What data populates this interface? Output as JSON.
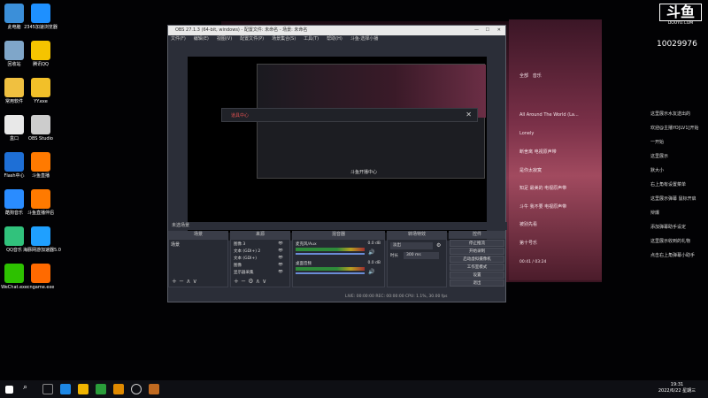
{
  "desktop": {
    "icons": [
      {
        "label": "此电脑",
        "color": "#3b8fd9"
      },
      {
        "label": "2345加速浏览器",
        "color": "#1e90ff"
      },
      {
        "label": "回收站",
        "color": "#7fa6c9"
      },
      {
        "label": "腾讯QQ",
        "color": "#f5c400"
      },
      {
        "label": "常用软件",
        "color": "#f0c040"
      },
      {
        "label": "YY.exe",
        "color": "#f2c029"
      },
      {
        "label": "盒口",
        "color": "#e8e8e8"
      },
      {
        "label": "OBS Studio",
        "color": "#cccccc"
      },
      {
        "label": "Flash中心",
        "color": "#1e6fd6"
      },
      {
        "label": "斗鱼直播",
        "color": "#ff7a00"
      },
      {
        "label": "酷狗音乐",
        "color": "#2a8cff"
      },
      {
        "label": "斗鱼直播伴侣",
        "color": "#ff7a00"
      },
      {
        "label": "QQ音乐",
        "color": "#31c27c"
      },
      {
        "label": "海豚网游加速器5.0",
        "color": "#1fa0ff"
      },
      {
        "label": "WeChat.exe",
        "color": "#2dc100"
      },
      {
        "label": "cngame.exe",
        "color": "#ff6a00"
      }
    ]
  },
  "douyu": {
    "logo": "斗鱼",
    "domain": "DOUYU.COM",
    "room_id": "10029976"
  },
  "obs": {
    "title": "OBS 27.1.3 (64-bit, windows) - 配置文件: 未命名 - 场景: 未命名",
    "menu": [
      "文件(F)",
      "编辑(E)",
      "视图(V)",
      "配置文件(P)",
      "场景集合(S)",
      "工具(T)",
      "帮助(H)",
      "斗鱼·选择小播"
    ],
    "preview_dialog": "道具中心",
    "inner_caption": "斗鱼开播中心",
    "docks": {
      "scenes": "场景",
      "sources": "来源",
      "mixer": "混音器",
      "transitions": "转场特效",
      "controls": "控件"
    },
    "scene_items": [
      "场景"
    ],
    "source_items": [
      "图像 3",
      "文本 (GDI+) 2",
      "文本 (GDI+)",
      "图像",
      "显示器采集"
    ],
    "mixer_items": [
      "麦克风/Aux",
      "桌面音频"
    ],
    "mixer_levels": [
      "0.0 dB",
      "0.0 dB"
    ],
    "transition": {
      "type": "淡出",
      "duration_label": "时长",
      "duration": "300 ms"
    },
    "controls": [
      "停止推流",
      "开始录制",
      "启动虚拟摄像机",
      "工作室模式",
      "设置",
      "退出"
    ],
    "status": "LIVE: 00:00:00   REC: 00:00:00   CPU: 1.1%, 30.00 fps"
  },
  "music": {
    "tabs": [
      "全部",
      "音乐"
    ],
    "tracks": [
      "All Around The World (La...",
      "Lonely",
      "断舍离 电视原声带",
      "是你太寂寞",
      "知足 最美的 电视原声带",
      "斗牛 我不要 电视原声带",
      "被别先看",
      "第十号乐"
    ],
    "time": "00:41 / 03:24"
  },
  "chat": {
    "lines": [
      "这里展示水友送出的",
      "欢迎@主播YO[LV1]开始",
      "一开始",
      "这里展示",
      "默大小",
      "右上角有设置菜单",
      "这里展示弹幕 鼠标开启",
      "辩爆",
      "添加弹幕助手设定",
      "这里展示收到的礼物",
      "点击右上角弹幕小助手"
    ]
  },
  "taskbar": {
    "time": "19:31",
    "date": "2022/6/22 星期三"
  }
}
